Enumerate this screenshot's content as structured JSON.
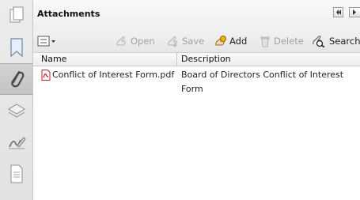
{
  "panel": {
    "title": "Attachments"
  },
  "toolbar": {
    "open_label": "Open",
    "save_label": "Save",
    "add_label": "Add",
    "delete_label": "Delete",
    "search_label": "Search"
  },
  "columns": {
    "name": "Name",
    "description": "Description"
  },
  "attachments": [
    {
      "name": "Conflict of Interest Form.pdf",
      "description": "Board of Directors Conflict of Interest Form"
    }
  ],
  "icons": {
    "sidebar": [
      "pages-icon",
      "bookmarks-icon",
      "attachments-icon",
      "layers-icon",
      "signatures-icon",
      "page-content-icon"
    ],
    "file": "pdf-file-icon"
  },
  "colors": {
    "pdf_red": "#c81e1e",
    "sidebar_bg": "#e6e6e6",
    "active_tab": "#c9c9c9"
  }
}
